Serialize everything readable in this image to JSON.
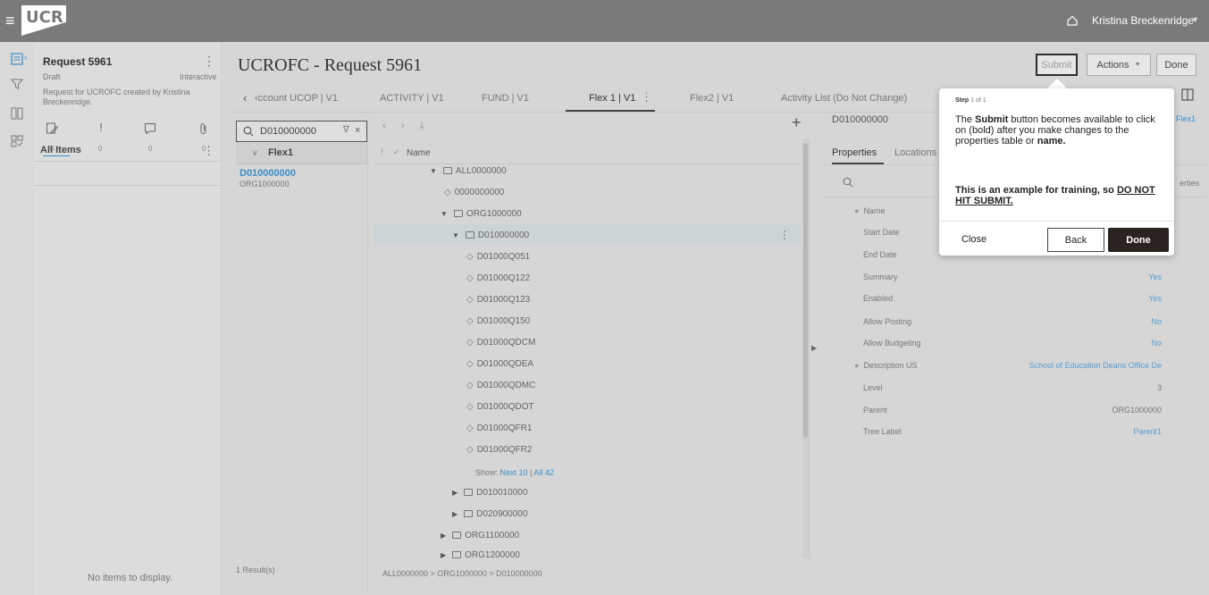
{
  "topbar": {
    "logo_text": "UCR",
    "user_name": "Kristina Breckenridge"
  },
  "request": {
    "title": "Request 5961",
    "status": "Draft",
    "mode": "Interactive",
    "description": "Request for UCROFC created by Kristina Breckenridge.",
    "counts": [
      "0",
      "0",
      "0",
      "0"
    ],
    "all_items_label": "All Items",
    "no_items_label": "No items to display."
  },
  "header": {
    "title": "UCROFC - Request 5961",
    "submit_label": "Submit",
    "actions_label": "Actions",
    "done_label": "Done"
  },
  "tabs": [
    {
      "label": "‹ccount UCOP | V1"
    },
    {
      "label": "ACTIVITY | V1"
    },
    {
      "label": "FUND | V1"
    },
    {
      "label": "Flex 1 | V1"
    },
    {
      "label": "Flex2 | V1"
    },
    {
      "label": "Activity List (Do Not Change)"
    }
  ],
  "search": {
    "value": "D010000000",
    "group_label": "Flex1",
    "result_title": "D010000000",
    "result_sub": "ORG1000000",
    "results_count": "1 Result(s)"
  },
  "tree": {
    "column_name": "Name",
    "rows": [
      {
        "label": "ALL0000000",
        "type": "folder"
      },
      {
        "label": "0000000000",
        "type": "leaf"
      },
      {
        "label": "ORG1000000",
        "type": "folder"
      },
      {
        "label": "D010000000",
        "type": "folder"
      },
      {
        "label": "D01000Q051",
        "type": "leaf"
      },
      {
        "label": "D01000Q122",
        "type": "leaf"
      },
      {
        "label": "D01000Q123",
        "type": "leaf"
      },
      {
        "label": "D01000Q150",
        "type": "leaf"
      },
      {
        "label": "D01000QDCM",
        "type": "leaf"
      },
      {
        "label": "D01000QDEA",
        "type": "leaf"
      },
      {
        "label": "D01000QDMC",
        "type": "leaf"
      },
      {
        "label": "D01000QDOT",
        "type": "leaf"
      },
      {
        "label": "D01000QFR1",
        "type": "leaf"
      },
      {
        "label": "D01000QFR2",
        "type": "leaf"
      },
      {
        "label": "D010010000",
        "type": "folder"
      },
      {
        "label": "D020900000",
        "type": "folder"
      },
      {
        "label": "ORG1100000",
        "type": "folder"
      },
      {
        "label": "ORG1200000",
        "type": "folder"
      }
    ],
    "show_label": "Show:",
    "next_label": "Next 10",
    "all_label": "All 42",
    "breadcrumb": "ALL0000000 > ORG1000000 > D010000000"
  },
  "properties": {
    "node_id": "D010000000",
    "tree_link": "Flex1",
    "tab_properties": "Properties",
    "tab_locations": "Locations",
    "cut_label": "erties",
    "rows": [
      {
        "label": "Name",
        "value": "",
        "required": true,
        "link": false
      },
      {
        "label": "Start Date",
        "value": "",
        "required": false,
        "link": false
      },
      {
        "label": "End Date",
        "value": "",
        "required": false,
        "link": false
      },
      {
        "label": "Summary",
        "value": "Yes",
        "required": false,
        "link": true
      },
      {
        "label": "Enabled",
        "value": "Yes",
        "required": false,
        "link": true
      },
      {
        "label": "Allow Posting",
        "value": "No",
        "required": false,
        "link": true
      },
      {
        "label": "Allow Budgeting",
        "value": "No",
        "required": false,
        "link": true
      },
      {
        "label": "Description US",
        "value": "School of Education Deans Office De",
        "required": true,
        "link": true
      },
      {
        "label": "Level",
        "value": "3",
        "required": false,
        "link": false
      },
      {
        "label": "Parent",
        "value": "ORG1000000",
        "required": false,
        "link": false
      },
      {
        "label": "Tree Label",
        "value": "Parent1",
        "required": false,
        "link": true
      }
    ]
  },
  "tooltip": {
    "step_label": "Step",
    "step_count": "1 of 1",
    "body_pre": "The",
    "body_bold": "Submit",
    "body_mid": "button becomes available to click on (bold) after you make changes to the properties table or",
    "body_bold2": "name",
    "body_end": ".",
    "warn_pre": "This is an example for training, so",
    "warn_underline": "DO NOT HIT SUBMIT.",
    "close_label": "Close",
    "back_label": "Back",
    "done_label": "Done"
  }
}
